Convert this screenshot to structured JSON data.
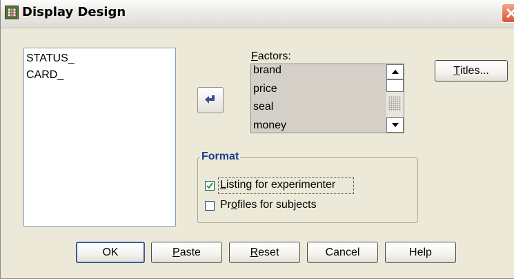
{
  "window": {
    "title": "Display Design",
    "app_icon": "spss-grid-icon",
    "close_icon": "close-x-icon"
  },
  "variables_list": {
    "items": [
      "STATUS_",
      "CARD_"
    ]
  },
  "move_button": {
    "icon": "arrow-left-icon"
  },
  "factors": {
    "label_accel": "F",
    "label_rest": "actors:",
    "items": [
      "brand",
      "price",
      "seal",
      "money"
    ],
    "scroll_up_icon": "triangle-up-icon",
    "scroll_down_icon": "triangle-down-icon"
  },
  "titles_button": {
    "accel": "T",
    "rest": "itles..."
  },
  "format_group": {
    "title": "Format",
    "listing": {
      "accel": "L",
      "rest": "isting for experimenter",
      "checked": true
    },
    "profiles": {
      "pre": "Pr",
      "accel": "o",
      "rest": "files for subjects",
      "checked": false
    }
  },
  "buttons": {
    "ok": "OK",
    "paste_accel": "P",
    "paste_rest": "aste",
    "reset_accel": "R",
    "reset_rest": "eset",
    "cancel": "Cancel",
    "help": "Help"
  }
}
